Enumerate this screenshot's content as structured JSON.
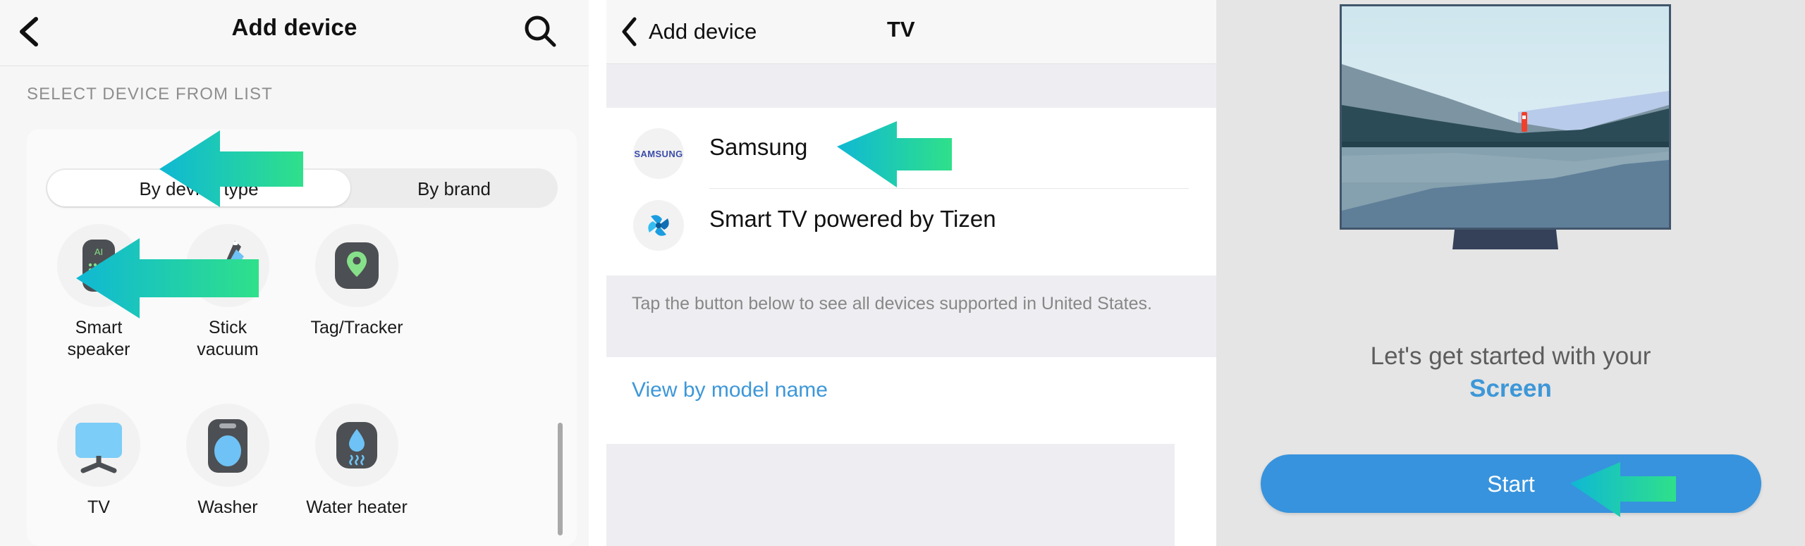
{
  "panel1": {
    "header": {
      "back_icon": "chevron-left-icon",
      "title": "Add device",
      "search_icon": "search-icon"
    },
    "section_label": "SELECT DEVICE FROM LIST",
    "segmented": {
      "selected": "By device type",
      "options": [
        "By device type",
        "By brand"
      ]
    },
    "devices": [
      {
        "label": "Smart\nspeaker",
        "label_line1": "Smart",
        "label_line2": "speaker",
        "icon": "smart-speaker-icon"
      },
      {
        "label": "Stick vacuum",
        "label_line1": "Stick",
        "label_line2": "vacuum",
        "icon": "stick-vacuum-icon"
      },
      {
        "label": "Tag/Tracker",
        "label_line1": "Tag/Tracker",
        "label_line2": "",
        "icon": "tag-tracker-icon"
      },
      {
        "label": "TV",
        "label_line1": "TV",
        "label_line2": "",
        "icon": "tv-icon"
      },
      {
        "label": "Washer",
        "label_line1": "Washer",
        "label_line2": "",
        "icon": "washer-icon"
      },
      {
        "label": "Water heater",
        "label_line1": "Water heater",
        "label_line2": "",
        "icon": "water-heater-icon"
      }
    ],
    "scrollbar": "vertical-scrollbar"
  },
  "panel2": {
    "header": {
      "back_icon": "chevron-left-icon",
      "back_label": "Add device",
      "title": "TV"
    },
    "brands": [
      {
        "name": "Samsung",
        "logo": "samsung-logo-icon",
        "logo_text": "SAMSUNG"
      },
      {
        "name": "Smart TV powered by Tizen",
        "logo": "tizen-logo-icon",
        "logo_text": ""
      }
    ],
    "info_text": "Tap the button below to see all devices supported in United States.",
    "link_label": "View by model name"
  },
  "panel3": {
    "illustration": "tv-landscape-illustration",
    "headline_prefix": "Let's get started with your",
    "headline_device": "Screen",
    "start_label": "Start"
  },
  "annotations": {
    "arrow_count": 3,
    "arrow_targets": [
      "By device type",
      "TV",
      "Samsung",
      "Start"
    ],
    "arrow_color_start": "#0fb8d4",
    "arrow_color_end": "#2fe08a"
  },
  "colors": {
    "accent_blue": "#3793dd",
    "link_blue": "#3d97d8",
    "panel_bg": "#e5e5e5",
    "card_bg": "#fafafa",
    "strip_bg": "#eeeef2"
  }
}
